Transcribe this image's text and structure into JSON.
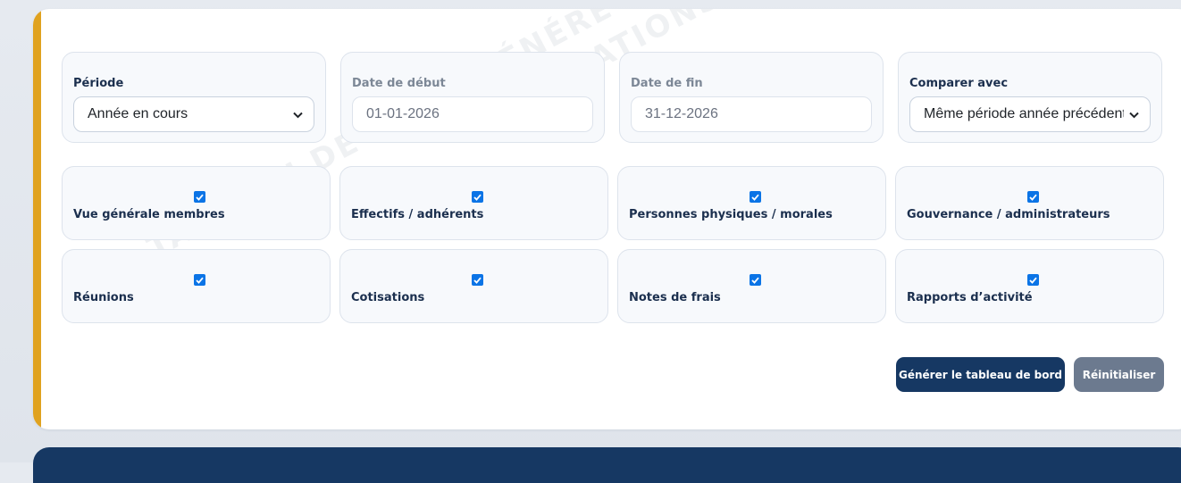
{
  "watermark": "TABLEAU DE BORD GÉNÉRÉ AUTOMATIQUEMENT PAR L'OUTIL DE GESTION DU CA",
  "watermark_line2": "ASSOCIATIONS ASBL",
  "colors": {
    "accent": "#e0a21f",
    "primary": "#163863",
    "secondary_button": "#6c7a8f",
    "checkbox": "#0b74e6"
  },
  "filters": {
    "periode": {
      "label": "Période",
      "value": "Année en cours"
    },
    "date_debut": {
      "label": "Date de début",
      "value": "01-01-2026",
      "disabled": true
    },
    "date_fin": {
      "label": "Date de fin",
      "value": "31-12-2026",
      "disabled": true
    },
    "comparer": {
      "label": "Comparer avec",
      "value": "Même période année précédente"
    }
  },
  "sections": [
    {
      "label": "Vue générale membres",
      "checked": true
    },
    {
      "label": "Effectifs / adhérents",
      "checked": true
    },
    {
      "label": "Personnes physiques / morales",
      "checked": true
    },
    {
      "label": "Gouvernance / administrateurs",
      "checked": true
    },
    {
      "label": "Réunions",
      "checked": true
    },
    {
      "label": "Cotisations",
      "checked": true
    },
    {
      "label": "Notes de frais",
      "checked": true
    },
    {
      "label": "Rapports d’activité",
      "checked": true
    }
  ],
  "actions": {
    "generate": "Générer le tableau de bord",
    "reset": "Réinitialiser"
  }
}
